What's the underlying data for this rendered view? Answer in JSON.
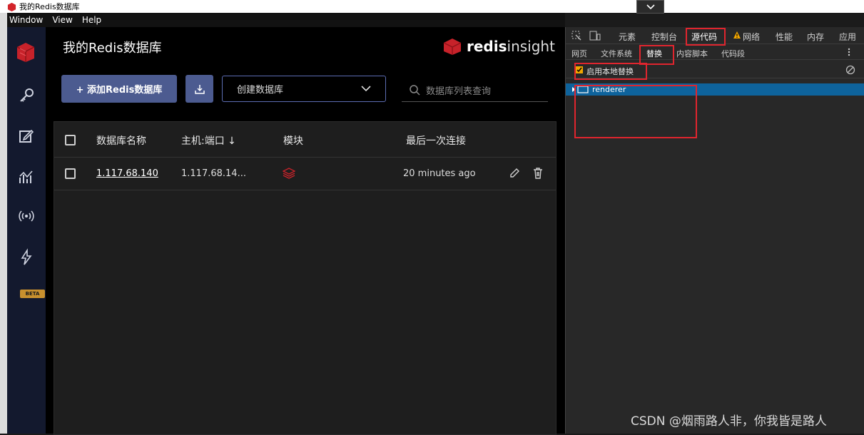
{
  "window": {
    "title": "我的Redis数据库",
    "menu": [
      "Window",
      "View",
      "Help"
    ]
  },
  "nav": {
    "items": [
      "redis-logo-icon",
      "key-icon",
      "edit-icon",
      "analytics-icon",
      "pubsub-icon",
      "workbench-icon"
    ],
    "beta_label": "BETA"
  },
  "app": {
    "title": "我的Redis数据库",
    "brand_bold": "redis",
    "brand_light": "insight",
    "add_button": "+ 添加Redis数据库",
    "create_select": "创建数据库",
    "search_placeholder": "数据库列表查询",
    "accent_color": "#4c5b90"
  },
  "table": {
    "headers": [
      "数据库名称",
      "主机:端口 ↓",
      "模块",
      "最后一次连接"
    ],
    "rows": [
      {
        "name": "1.117.68.140",
        "host": "1.117.68.14...",
        "module": "stack-icon",
        "last": "20 minutes ago"
      }
    ]
  },
  "devtools": {
    "tabs": [
      "元素",
      "控制台",
      "源代码",
      "网络",
      "性能",
      "内存",
      "应用"
    ],
    "subtabs": [
      "网页",
      "文件系统",
      "替换",
      "内容脚本",
      "代码段"
    ],
    "enable_label": "启用本地替换",
    "tree_item": "renderer",
    "highlight_color": "#e0252e"
  },
  "watermark": "CSDN @烟雨路人非，你我皆是路人"
}
